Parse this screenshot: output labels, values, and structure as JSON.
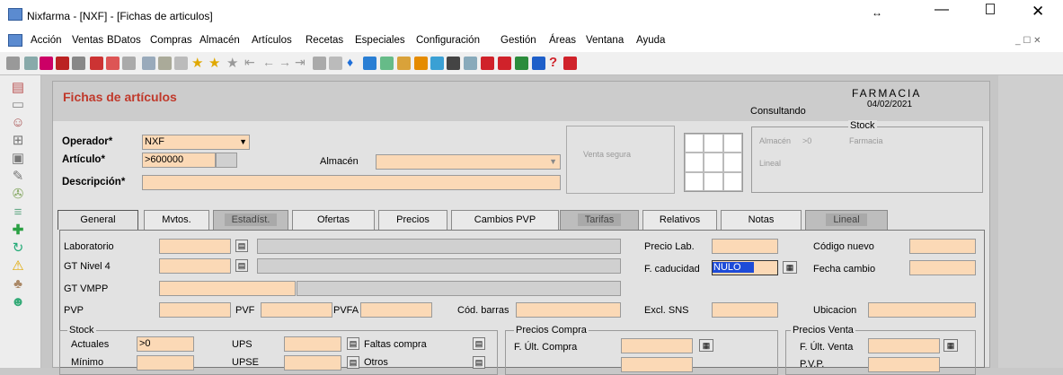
{
  "window": {
    "title": "Nixfarma - [NXF] - [Fichas de articulos]"
  },
  "menu": [
    "Acción",
    "Ventas",
    "BDatos",
    "Compras",
    "Almacén",
    "Artículos",
    "Recetas",
    "Especiales",
    "Configuración",
    "Gestión",
    "Áreas",
    "Ventana",
    "Ayuda"
  ],
  "colors": {
    "field": "#fbd9b6",
    "title_red": "#c0392b",
    "highlight": "#1e4bd8"
  },
  "header": {
    "title": "Fichas de artículos",
    "mode": "Consultando",
    "company": "FARMACIA",
    "date": "04/02/2021"
  },
  "form": {
    "operador_label": "Operador*",
    "operador_value": "NXF",
    "articulo_label": "Artículo*",
    "articulo_value": ">600000",
    "almacen_label": "Almacén",
    "almacen_value": "",
    "descripcion_label": "Descripción*",
    "descripcion_value": "",
    "venta_segura": "Venta segura",
    "stock_title": "Stock",
    "almacen_stock_label": "Almacén",
    "almacen_stock_value": ">0",
    "farmacia_label": "Farmacia",
    "lineal_stock_label": "Lineal"
  },
  "tabs": [
    {
      "label": "General",
      "state": "active"
    },
    {
      "label": "Mvtos.",
      "state": "normal"
    },
    {
      "label": "Estadíst.",
      "state": "disabled"
    },
    {
      "label": "Ofertas",
      "state": "normal"
    },
    {
      "label": "Precios",
      "state": "normal"
    },
    {
      "label": "Cambios PVP",
      "state": "normal"
    },
    {
      "label": "Tarifas",
      "state": "disabled"
    },
    {
      "label": "Relativos",
      "state": "normal"
    },
    {
      "label": "Notas",
      "state": "normal"
    },
    {
      "label": "Lineal",
      "state": "disabled"
    }
  ],
  "general": {
    "laboratorio": "Laboratorio",
    "gt_nivel4": "GT Nivel 4",
    "gt_vmpp": "GT VMPP",
    "pvp": "PVP",
    "pvf": "PVF",
    "pvfa": "PVFA",
    "cod_barras": "Cód. barras",
    "precio_lab": "Precio Lab.",
    "f_caducidad": "F. caducidad",
    "f_caducidad_value": "NULO",
    "excl_sns": "Excl. SNS",
    "codigo_nuevo": "Código nuevo",
    "fecha_cambio": "Fecha cambio",
    "ubicacion": "Ubicacion",
    "stock_title": "Stock",
    "actuales": "Actuales",
    "actuales_value": ">0",
    "minimo": "Mínimo",
    "ups": "UPS",
    "upse": "UPSE",
    "faltas_compra": "Faltas compra",
    "otros": "Otros",
    "precios_compra_title": "Precios Compra",
    "f_ult_compra": "F. Últ. Compra",
    "precios_venta_title": "Precios Venta",
    "f_ult_venta": "F. Últ. Venta",
    "pvp2": "P.V.P."
  }
}
